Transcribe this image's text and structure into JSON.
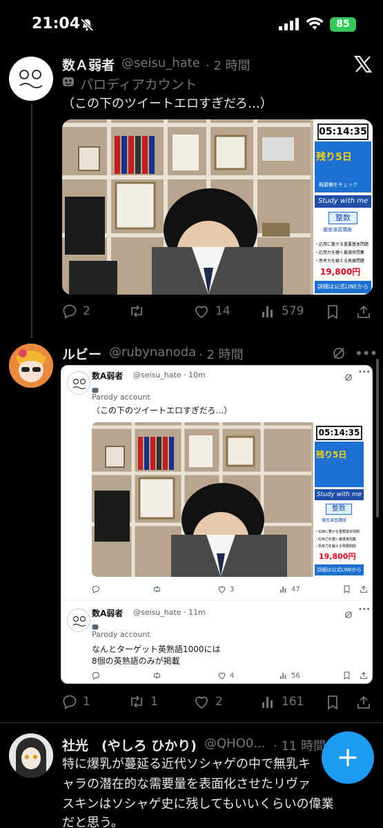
{
  "status_bar": {
    "time": "21:04",
    "battery": "85"
  },
  "tweets": [
    {
      "name": "数Ａ弱者",
      "handle": "@seisu_hate",
      "time": "· 2 時間",
      "badge": "パロディアカウント",
      "text": "（この下のツイートエロすぎだろ…）",
      "media": {
        "timer": "05:14:35",
        "ad_banner": "残り5日",
        "ad_check": "概要欄をチェック",
        "study": "Study with me",
        "course_title": "整数",
        "course_sub": "徹底演習講座",
        "bullets": [
          "・応用に繋がる重要基本問題",
          "・応用力を磨く厳選良問集",
          "・思考力を鍛える発展問題"
        ],
        "price": "19,800円",
        "footer": "詳細は公式LINEから"
      },
      "actions": {
        "replies": "2",
        "retweets": "",
        "likes": "14",
        "views": "579"
      }
    },
    {
      "name": "ルビー",
      "handle": "@rubynanoda",
      "time": "· 2 時間",
      "quote": {
        "tweet1": {
          "name": "数A弱者",
          "handle": "@seisu_hate · 10m",
          "badge": "Parody account",
          "text": "（この下のツイートエロすぎだろ…）",
          "actions": {
            "likes": "3",
            "views": "47"
          }
        },
        "tweet2": {
          "name": "数A弱者",
          "handle": "@seisu_hate · 11m",
          "badge": "Parody account",
          "line1": "なんとターゲット英熟語1000には",
          "line2": "8個の英熟語のみが掲載",
          "actions": {
            "likes": "4",
            "views": "56"
          }
        }
      },
      "actions": {
        "replies": "1",
        "retweets": "1",
        "likes": "2",
        "views": "161"
      }
    },
    {
      "name": "社光　(やしろ ひかり)",
      "handle": "@QHO0...",
      "time": "· 11 時間",
      "lines": [
        "特に爆乳が蔓延る近代ソシャゲの中で無乳キ",
        "ャラの潜在的な需要量を表面化させたリヴァ",
        "スキンはソシャゲ史に残してもいいくらいの偉業",
        "だと思う。"
      ]
    }
  ],
  "colors": {
    "accent": "#1d9bf0",
    "battery": "#34c759",
    "muted": "#71767b",
    "price": "#e0001b"
  }
}
